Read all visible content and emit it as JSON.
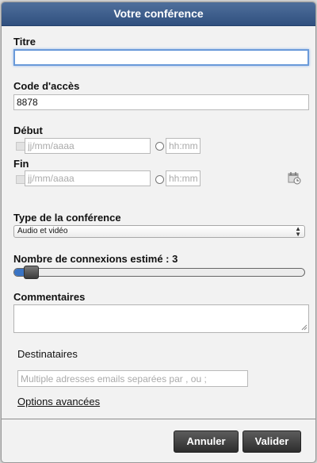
{
  "dialog": {
    "title": "Votre conférence"
  },
  "form": {
    "titre": {
      "label": "Titre",
      "value": ""
    },
    "code": {
      "label": "Code d'accès",
      "value": "8878"
    },
    "debut": {
      "label": "Début",
      "date_placeholder": "jj/mm/aaaa",
      "time_placeholder": "hh:mm"
    },
    "fin": {
      "label": "Fin",
      "date_placeholder": "jj/mm/aaaa",
      "time_placeholder": "hh:mm"
    },
    "type": {
      "label": "Type de la conférence",
      "selected": "Audio et vidéo"
    },
    "connexions": {
      "label": "Nombre de connexions estimé : 3",
      "value": 3
    },
    "commentaires": {
      "label": "Commentaires",
      "value": ""
    },
    "destinataires": {
      "label": "Destinataires",
      "placeholder": "Multiple adresses emails separées par , ou ;"
    },
    "options_link": "Options avancées"
  },
  "buttons": {
    "cancel": "Annuler",
    "submit": "Valider"
  },
  "colors": {
    "titlebar": "#3b5b8a",
    "slider_fill": "#3a74c4",
    "focus": "#6a9ad9"
  },
  "icons": {
    "date": "calendar-icon",
    "time": "clock-radio",
    "schedule": "calendar-clock-icon"
  }
}
